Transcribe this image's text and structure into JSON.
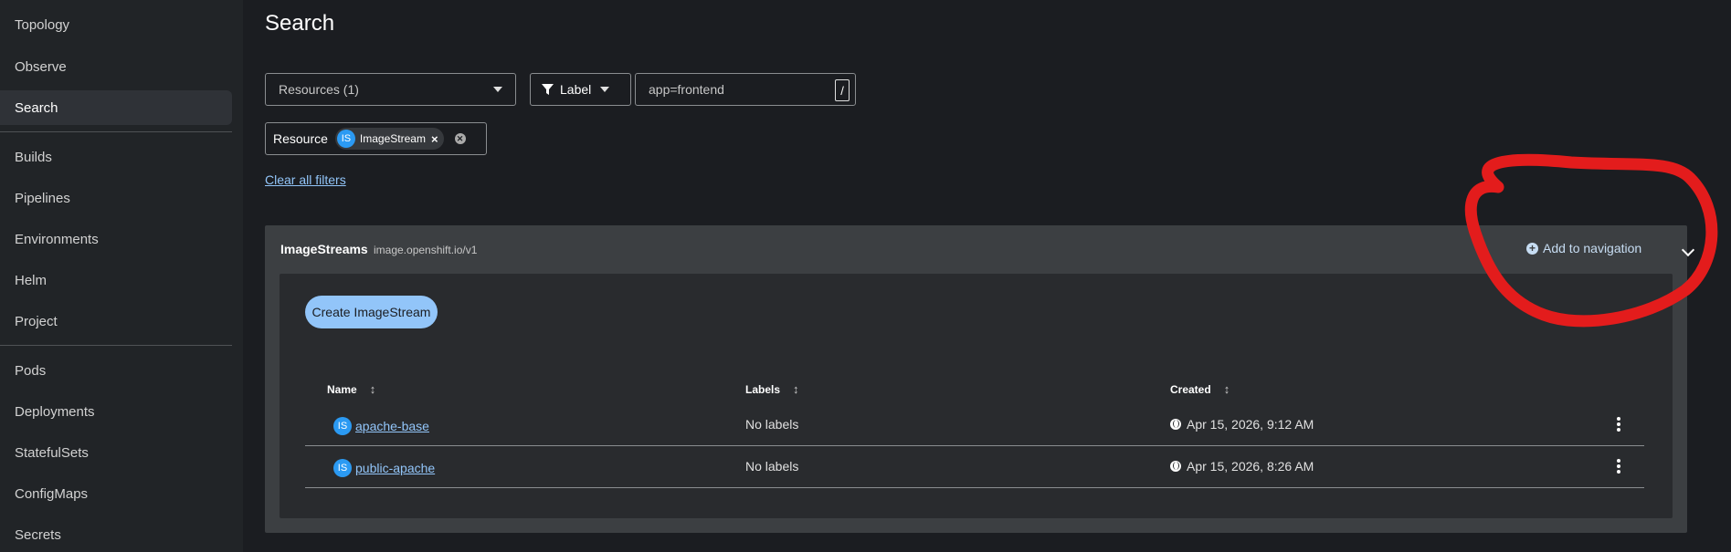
{
  "sidebar": {
    "items": [
      {
        "label": "Topology"
      },
      {
        "label": "Observe"
      },
      {
        "label": "Search"
      },
      {
        "label": "Builds"
      },
      {
        "label": "Pipelines"
      },
      {
        "label": "Environments"
      },
      {
        "label": "Helm"
      },
      {
        "label": "Project"
      },
      {
        "label": "Pods"
      },
      {
        "label": "Deployments"
      },
      {
        "label": "StatefulSets"
      },
      {
        "label": "ConfigMaps"
      },
      {
        "label": "Secrets"
      }
    ],
    "active": "Search"
  },
  "header": {
    "title": "Search"
  },
  "filters": {
    "resources_select": "Resources (1)",
    "label_button": "Label",
    "label_input": "app=frontend",
    "shortcut": "/",
    "chip_group_label": "Resource",
    "chip_badge": "IS",
    "chip_label": "ImageStream",
    "chip_close": "×",
    "clear_all": "Clear all filters"
  },
  "panel": {
    "title": "ImageStreams",
    "api_version": "image.openshift.io/v1",
    "add_nav": "Add to navigation",
    "create_button": "Create ImageStream",
    "columns": [
      "Name",
      "Labels",
      "Created"
    ],
    "rows": [
      {
        "badge": "IS",
        "name": "apache-base",
        "labels": "No labels",
        "created": "Apr 15, 2026, 9:12 AM"
      },
      {
        "badge": "IS",
        "name": "public-apache",
        "labels": "No labels",
        "created": "Apr 15, 2026, 8:26 AM"
      }
    ]
  },
  "colors": {
    "accent_link": "#92c5f9",
    "badge_blue": "#2b9af3",
    "annotation_red": "#e31c1c"
  }
}
